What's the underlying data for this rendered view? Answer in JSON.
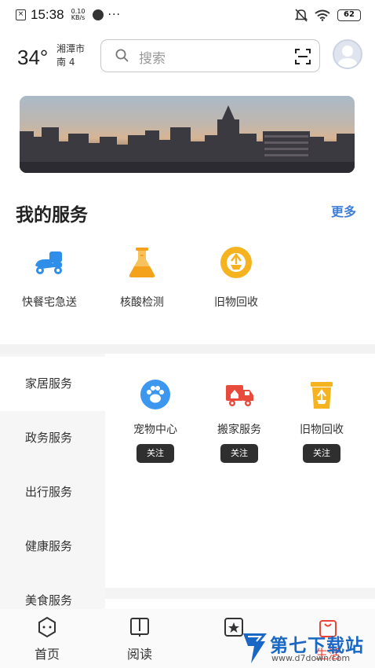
{
  "status_bar": {
    "time": "15:38",
    "speed_value": "0.10",
    "speed_unit": "KB/s",
    "more": "···",
    "battery": "62"
  },
  "header": {
    "temperature": "34°",
    "city": "湘潭市",
    "wind": "南 4",
    "search_placeholder": "搜索"
  },
  "my_services": {
    "title": "我的服务",
    "more": "更多",
    "items": [
      {
        "label": "快餐宅急送",
        "icon": "delivery-scooter-icon",
        "color": "#2f8fe8"
      },
      {
        "label": "核酸检测",
        "icon": "flask-icon",
        "color": "#f4a21c"
      },
      {
        "label": "旧物回收",
        "icon": "recycle-badge-icon",
        "color": "#f5b31f"
      }
    ]
  },
  "categories": {
    "items": [
      "家居服务",
      "政务服务",
      "出行服务",
      "健康服务",
      "美食服务"
    ],
    "active_index": 0,
    "tiles": [
      {
        "label": "宠物中心",
        "button": "关注",
        "icon": "paw-icon",
        "color": "#3d97ef"
      },
      {
        "label": "搬家服务",
        "button": "关注",
        "icon": "moving-truck-icon",
        "color": "#e84a3c"
      },
      {
        "label": "旧物回收",
        "button": "关注",
        "icon": "recycle-bin-icon",
        "color": "#f5b31f"
      }
    ]
  },
  "tab_bar": {
    "items": [
      {
        "label": "首页",
        "icon": "home-icon"
      },
      {
        "label": "阅读",
        "icon": "book-icon"
      },
      {
        "label": "",
        "icon": "star-box-icon"
      },
      {
        "label": "生活",
        "icon": "bag-icon"
      }
    ]
  },
  "watermark": {
    "text": "第七下载站",
    "url": "www.d7down.com"
  }
}
